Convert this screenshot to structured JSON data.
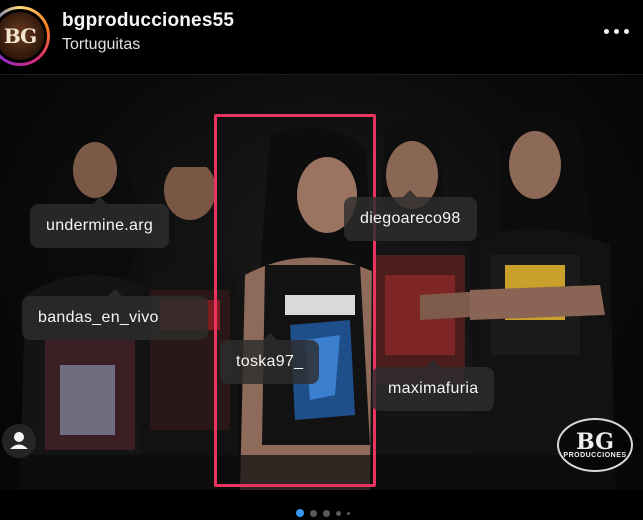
{
  "post": {
    "username": "bgproducciones55",
    "location": "Tortuguitas",
    "avatar_text": "BG"
  },
  "tags": [
    {
      "label": "undermine.arg"
    },
    {
      "label": "diegoareco98"
    },
    {
      "label": "bandas_en_vivo"
    },
    {
      "label": "toska97_"
    },
    {
      "label": "maximafuria"
    }
  ],
  "watermark": {
    "top": "BG",
    "bottom": "PRODUCCIONES"
  },
  "carousel": {
    "count": 5,
    "active_index": 0
  },
  "colors": {
    "highlight": "#e8345f",
    "active_dot": "#3897f0"
  },
  "icons": {
    "more": "more-horizontal-icon",
    "user": "user-tag-icon"
  }
}
